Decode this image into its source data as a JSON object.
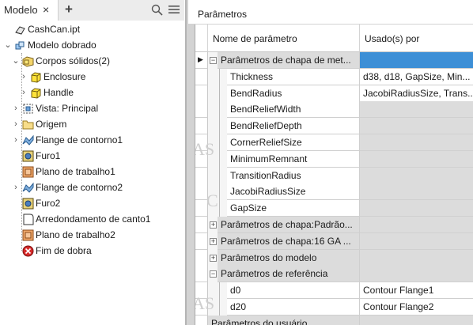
{
  "browser": {
    "tab_label": "Modelo",
    "close_glyph": "×",
    "add_glyph": "+",
    "tree": [
      {
        "label": "CashCan.ipt",
        "icon": "part-file-icon",
        "level": 0,
        "chevron": ""
      },
      {
        "label": "Modelo dobrado",
        "icon": "folded-model-icon",
        "level": 0,
        "chevron": "⌄"
      },
      {
        "label": "Corpos sólidos(2)",
        "icon": "solid-bodies-icon",
        "level": 1,
        "chevron": "⌄"
      },
      {
        "label": "Enclosure",
        "icon": "solid-body-icon",
        "level": 2,
        "chevron": "›"
      },
      {
        "label": "Handle",
        "icon": "solid-body-icon",
        "level": 2,
        "chevron": "›"
      },
      {
        "label": "Vista: Principal",
        "icon": "view-icon",
        "level": 1,
        "chevron": "›"
      },
      {
        "label": "Origem",
        "icon": "origin-folder-icon",
        "level": 1,
        "chevron": "›"
      },
      {
        "label": "Flange de contorno1",
        "icon": "contour-flange-icon",
        "level": 1,
        "chevron": "›"
      },
      {
        "label": "Furo1",
        "icon": "hole-icon",
        "level": 1,
        "chevron": ""
      },
      {
        "label": "Plano de trabalho1",
        "icon": "work-plane-icon",
        "level": 1,
        "chevron": ""
      },
      {
        "label": "Flange de contorno2",
        "icon": "contour-flange-icon",
        "level": 1,
        "chevron": "›"
      },
      {
        "label": "Furo2",
        "icon": "hole-icon",
        "level": 1,
        "chevron": ""
      },
      {
        "label": "Arredondamento de canto1",
        "icon": "corner-round-icon",
        "level": 1,
        "chevron": ""
      },
      {
        "label": "Plano de trabalho2",
        "icon": "work-plane-icon",
        "level": 1,
        "chevron": ""
      },
      {
        "label": "Fim de dobra",
        "icon": "end-of-fold-icon",
        "level": 1,
        "chevron": ""
      }
    ]
  },
  "params": {
    "title": "Parâmetros",
    "col_name": "Nome de parâmetro",
    "col_used": "Usado(s) por",
    "row_pointer": "▶",
    "rows": [
      {
        "kind": "group",
        "exp": "−",
        "name": "Parâmetros de chapa de met...",
        "used": "",
        "selected": true
      },
      {
        "kind": "param",
        "name": "Thickness",
        "used": "d38, d18, GapSize, Min..."
      },
      {
        "kind": "param",
        "name": "BendRadius",
        "used": "JacobiRadiusSize, Trans..."
      },
      {
        "kind": "param",
        "name": "BendReliefWidth",
        "used": ""
      },
      {
        "kind": "param",
        "name": "BendReliefDepth",
        "used": ""
      },
      {
        "kind": "param",
        "name": "CornerReliefSize",
        "used": ""
      },
      {
        "kind": "param",
        "name": "MinimumRemnant",
        "used": ""
      },
      {
        "kind": "param",
        "name": "TransitionRadius",
        "used": ""
      },
      {
        "kind": "param",
        "name": "JacobiRadiusSize",
        "used": ""
      },
      {
        "kind": "param",
        "name": "GapSize",
        "used": ""
      },
      {
        "kind": "group",
        "exp": "+",
        "name": "Parâmetros de chapa:Padrão...",
        "used": ""
      },
      {
        "kind": "group",
        "exp": "+",
        "name": "Parâmetros de chapa:16 GA ...",
        "used": ""
      },
      {
        "kind": "group",
        "exp": "+",
        "name": "Parâmetros do modelo",
        "used": ""
      },
      {
        "kind": "group",
        "exp": "−",
        "name": "Parâmetros de referência",
        "used": ""
      },
      {
        "kind": "param",
        "name": "d0",
        "used": "Contour Flange1"
      },
      {
        "kind": "param",
        "name": "d20",
        "used": "Contour Flange2"
      },
      {
        "kind": "group",
        "exp": "",
        "name": "Parâmetros do usuário",
        "used": ""
      }
    ]
  },
  "colors": {
    "selection_blue": "#3d8fd6",
    "group_gray": "#dcdcdc",
    "panel_gray": "#d3d3d3"
  }
}
